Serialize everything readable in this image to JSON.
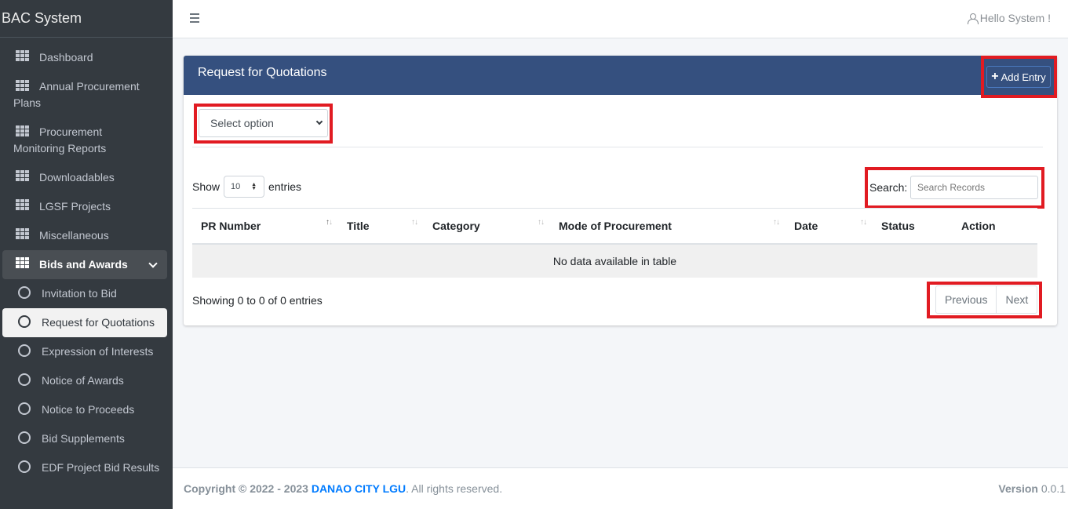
{
  "app": {
    "brand": "BAC System"
  },
  "sidebar": {
    "items": [
      {
        "label": "Dashboard"
      },
      {
        "label_line1": "Annual Procurement",
        "label_line2": "Plans"
      },
      {
        "label_line1": "Procurement",
        "label_line2": "Monitoring Reports"
      },
      {
        "label": "Downloadables"
      },
      {
        "label": "LGSF Projects"
      },
      {
        "label": "Miscellaneous"
      },
      {
        "label": "Bids and Awards"
      }
    ],
    "subitems": [
      {
        "label": "Invitation to Bid"
      },
      {
        "label": "Request for Quotations"
      },
      {
        "label": "Expression of Interests"
      },
      {
        "label": "Notice of Awards"
      },
      {
        "label": "Notice to Proceeds"
      },
      {
        "label": "Bid Supplements"
      },
      {
        "label": "EDF Project Bid Results"
      }
    ]
  },
  "header": {
    "greeting": "Hello System !"
  },
  "card": {
    "title": "Request for Quotations",
    "add_label": "Add Entry",
    "select_value": "Select option",
    "show_label": "Show",
    "length_value": "10",
    "entries_label": "entries",
    "search_label": "Search:",
    "search_placeholder": "Search Records",
    "columns": [
      "PR Number",
      "Title",
      "Category",
      "Mode of Procurement",
      "Date",
      "Status",
      "Action"
    ],
    "empty_text": "No data available in table",
    "info": "Showing 0 to 0 of 0 entries",
    "prev": "Previous",
    "next": "Next"
  },
  "footer": {
    "copyright": "Copyright © 2022 - 2023",
    "org": "DANAO CITY LGU",
    "rights": ". All rights reserved.",
    "version_label": "Version",
    "version": "0.0.1"
  },
  "colors": {
    "sidebar": "#343a40",
    "card_header": "#35507f",
    "highlight": "#e11b22",
    "link": "#007bff"
  }
}
